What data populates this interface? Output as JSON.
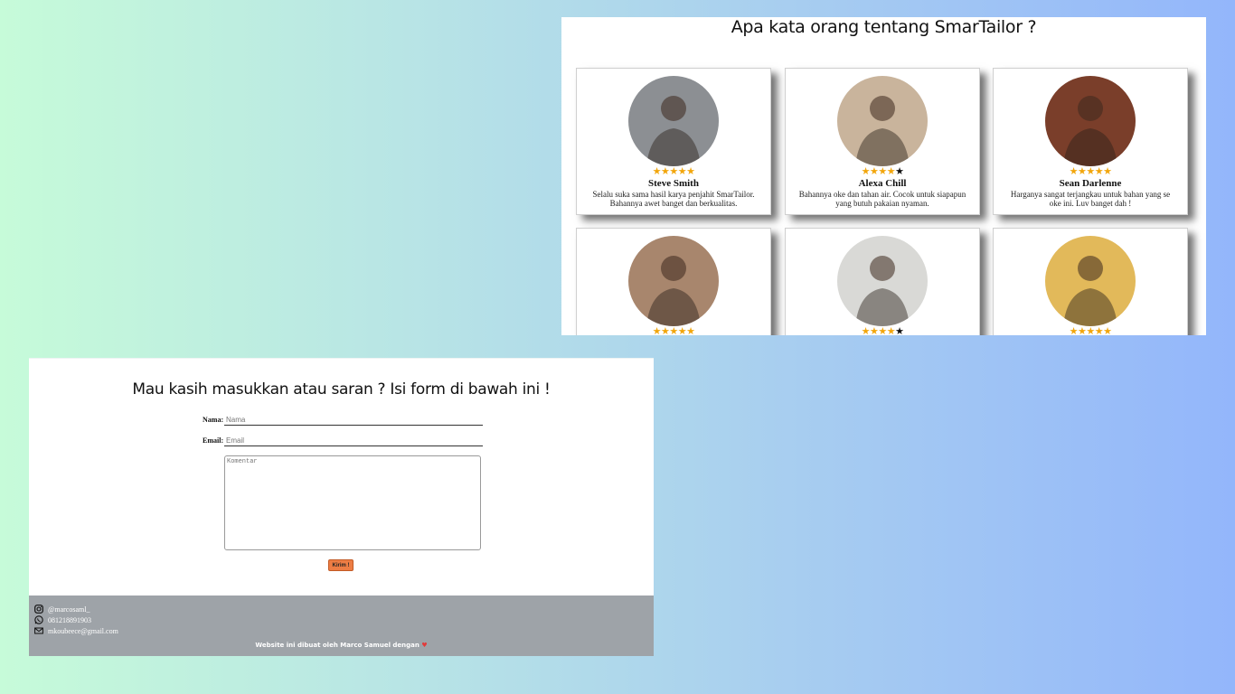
{
  "testimonials": {
    "title": "Apa kata orang tentang SmarTailor ?",
    "cards": [
      {
        "name": "Steve Smith",
        "rating": 5,
        "text": "Selalu suka sama hasil karya penjahit SmarTailor. Bahannya awet banget dan berkualitas.",
        "photo_bg": "#8c8f93"
      },
      {
        "name": "Alexa Chill",
        "rating": 4,
        "text": "Bahannya oke dan tahan air. Cocok untuk siapapun yang butuh pakaian nyaman.",
        "photo_bg": "#c9b49c"
      },
      {
        "name": "Sean Darlenne",
        "rating": 5,
        "text": "Harganya sangat terjangkau untuk bahan yang se oke ini. Luv banget dah !",
        "photo_bg": "#7a3e2a"
      },
      {
        "name": "",
        "rating": 5,
        "text": "",
        "photo_bg": "#a8866d"
      },
      {
        "name": "",
        "rating": 4,
        "text": "",
        "photo_bg": "#d9d9d6"
      },
      {
        "name": "",
        "rating": 5,
        "text": "",
        "photo_bg": "#e2b95a"
      }
    ]
  },
  "feedback": {
    "title": "Mau kasih masukkan atau saran ? Isi form di bawah ini !",
    "name_label": "Nama:",
    "name_placeholder": "Nama",
    "email_label": "Email:",
    "email_placeholder": "Email",
    "comment_placeholder": "Komentar",
    "submit_label": "Kirim !"
  },
  "footer": {
    "instagram": "@marcosaml_",
    "whatsapp": "081218891903",
    "email": "mkoubeece@gmail.com",
    "credit": "Website ini dibuat oleh Marco Samuel dengan",
    "heart": "♥"
  },
  "colors": {
    "accent": "#ed7d44",
    "star": "#f2a60c",
    "footer_bg": "#9ea3a8"
  }
}
